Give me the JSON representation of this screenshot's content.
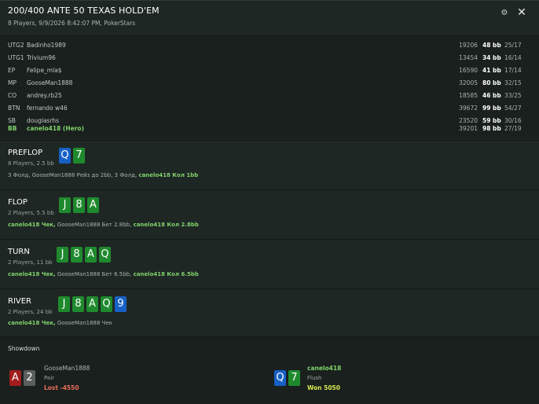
{
  "header": {
    "title": "200/400 ANTE 50 TEXAS HOLD'EM",
    "subtitle": "8 Players, 9/9/2026 8:42:07 PM, PokerStars"
  },
  "players": [
    {
      "pos": "UTG2",
      "name": "Badinho1989",
      "stack": "19206",
      "bb": "48 bb",
      "ratio": "25/17"
    },
    {
      "pos": "UTG1",
      "name": "Trivium96",
      "stack": "13454",
      "bb": "34 bb",
      "ratio": "16/14"
    },
    {
      "pos": "EP",
      "name": "Felipe_mla$",
      "stack": "16590",
      "bb": "41 bb",
      "ratio": "17/14"
    },
    {
      "pos": "MP",
      "name": "GooseMan1888",
      "stack": "32005",
      "bb": "80 bb",
      "ratio": "32/15"
    },
    {
      "pos": "CO",
      "name": "andrey.rb25",
      "stack": "18585",
      "bb": "46 bb",
      "ratio": "33/25"
    },
    {
      "pos": "BTN",
      "name": "fernando w46",
      "stack": "39672",
      "bb": "99 bb",
      "ratio": "54/27"
    },
    {
      "pos": "SB",
      "name": "douglasrhs",
      "stack": "23520",
      "bb": "59 bb",
      "ratio": "30/16"
    },
    {
      "pos": "BB",
      "name": "canelo418 (Hero)",
      "stack": "39201",
      "bb": "98 bb",
      "ratio": "27/19"
    }
  ],
  "streets": {
    "preflop": {
      "name": "PREFLOP",
      "info": "8 Players, 2.5 bb",
      "cards": [
        {
          "rank": "Q",
          "suit": "diamond"
        },
        {
          "rank": "7",
          "suit": "club"
        }
      ],
      "act1": "3 Фолд, GooseMan1888 Рейз до 2bb, 3 Фолд,",
      "act2": "canelo418 Кол 1bb"
    },
    "flop": {
      "name": "FLOP",
      "info": "2 Players, 5.5 bb",
      "cards": [
        {
          "rank": "J",
          "suit": "club"
        },
        {
          "rank": "8",
          "suit": "club"
        },
        {
          "rank": "A",
          "suit": "club"
        }
      ],
      "act1": "canelo418 Чек,",
      "act2": "GooseMan1888 Бет 2.8bb,",
      "act3": "canelo418 Кол 2.8bb"
    },
    "turn": {
      "name": "TURN",
      "info": "2 Players, 11 bb",
      "cards": [
        {
          "rank": "J",
          "suit": "club"
        },
        {
          "rank": "8",
          "suit": "club"
        },
        {
          "rank": "A",
          "suit": "club"
        },
        {
          "rank": "Q",
          "suit": "club"
        }
      ],
      "act1": "canelo418 Чек,",
      "act2": "GooseMan1888 Бет 6.5bb,",
      "act3": "canelo418 Кол 6.5bb"
    },
    "river": {
      "name": "RIVER",
      "info": "2 Players, 24 bb",
      "cards": [
        {
          "rank": "J",
          "suit": "club"
        },
        {
          "rank": "8",
          "suit": "club"
        },
        {
          "rank": "A",
          "suit": "club"
        },
        {
          "rank": "Q",
          "suit": "club"
        },
        {
          "rank": "9",
          "suit": "diamond"
        }
      ],
      "act1": "canelo418 Чек,",
      "act2": "GooseMan1888 Чек"
    }
  },
  "showdown": {
    "title": "Showdown",
    "villain": {
      "name": "GooseMan1888",
      "hand": "Pair",
      "result": "Lost -4550",
      "cards": [
        {
          "rank": "A",
          "suit": "heart"
        },
        {
          "rank": "2",
          "suit": "spade"
        }
      ]
    },
    "hero": {
      "name": "canelo418",
      "hand": "Flush",
      "result": "Won 5050",
      "cards": [
        {
          "rank": "Q",
          "suit": "diamond"
        },
        {
          "rank": "7",
          "suit": "club"
        }
      ]
    }
  },
  "icons": {
    "settings": "gear-icon",
    "close": "close-icon"
  },
  "colors": {
    "hero": "#7fd26a",
    "club": "#1f8a2d",
    "diamond": "#1760c5",
    "heart": "#a11d1d",
    "spade": "#5a5f5e",
    "won": "#d7e84d",
    "lost": "#e86b5a"
  }
}
